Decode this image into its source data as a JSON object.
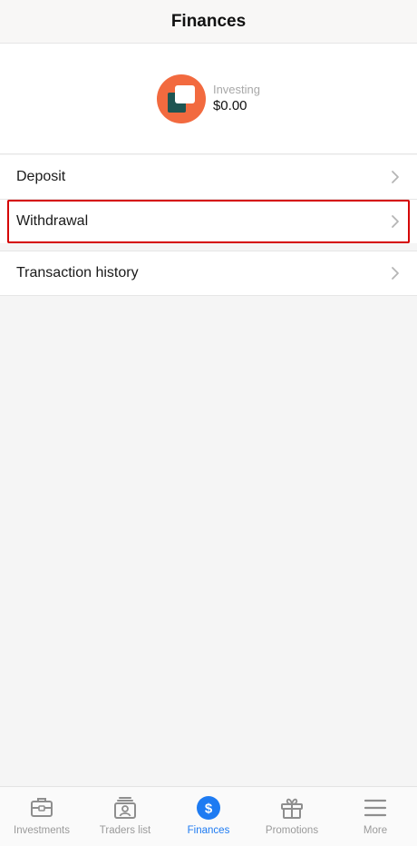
{
  "header": {
    "title": "Finances"
  },
  "account": {
    "label": "Investing",
    "balance": "$0.00"
  },
  "menu": {
    "deposit": "Deposit",
    "withdrawal": "Withdrawal",
    "history": "Transaction history"
  },
  "tabs": [
    {
      "label": "Investments",
      "icon": "briefcase-icon"
    },
    {
      "label": "Traders list",
      "icon": "trader-card-icon"
    },
    {
      "label": "Finances",
      "icon": "dollar-icon",
      "active": true
    },
    {
      "label": "Promotions",
      "icon": "gift-icon"
    },
    {
      "label": "More",
      "icon": "hamburger-icon"
    }
  ],
  "colors": {
    "accent": "#1e7bf2",
    "logo_orange": "#f26a3f",
    "logo_teal": "#1e5552",
    "highlight": "#d50000"
  }
}
